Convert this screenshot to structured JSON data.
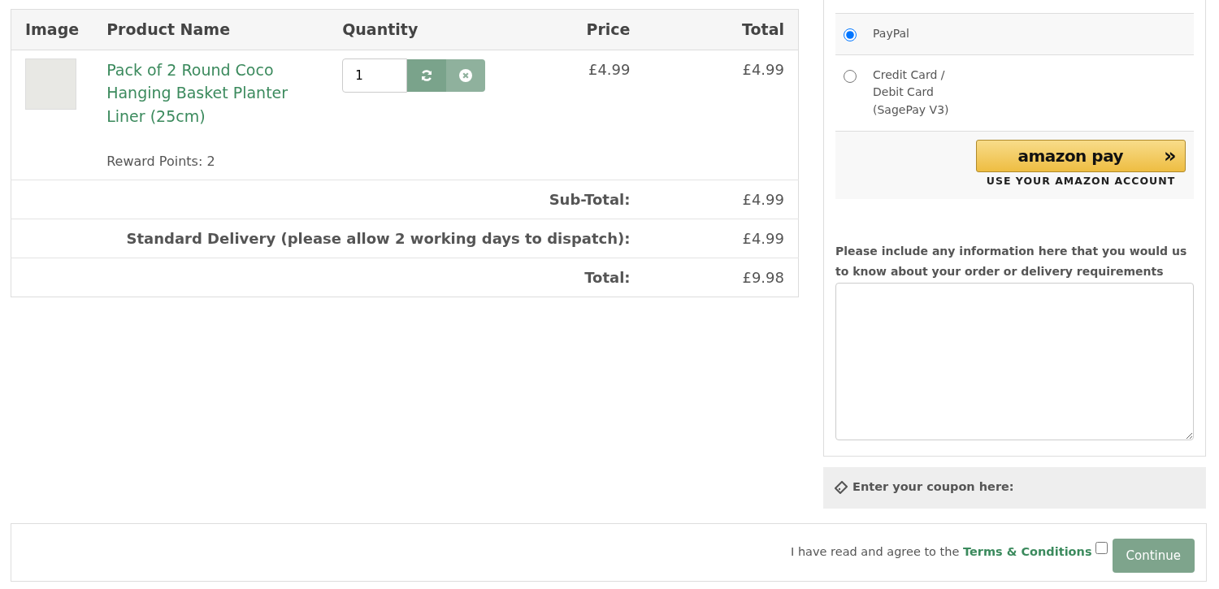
{
  "cart": {
    "columns": [
      {
        "label": "Image"
      },
      {
        "label": "Product Name"
      },
      {
        "label": "Quantity"
      },
      {
        "label": "Price"
      },
      {
        "label": "Total"
      }
    ],
    "items": [
      {
        "name": "Pack of 2 Round Coco Hanging Basket Planter Liner (25cm)",
        "reward": "Reward Points: 2",
        "quantity": "1",
        "price": "£4.99",
        "total": "£4.99"
      }
    ],
    "totals": [
      {
        "label": "Sub-Total:",
        "value": "£4.99"
      },
      {
        "label": "Standard Delivery (please allow 2 working days to dispatch):",
        "value": "£4.99"
      },
      {
        "label": "Total:",
        "value": "£9.98"
      }
    ]
  },
  "payment": {
    "methods": [
      {
        "label": "PayPal",
        "selected": true
      },
      {
        "label": "Credit Card /\nDebit Card\n(SagePay V3)",
        "selected": false
      }
    ],
    "amazon": {
      "logo": "amazon pay",
      "chevrons": "»",
      "caption": "USE YOUR AMAZON ACCOUNT"
    },
    "comment_label": "Please include any information here that you would us to know about your order or delivery requirements"
  },
  "coupon": {
    "label": "Enter your coupon here:"
  },
  "footer": {
    "agree_text": "I have read and agree to the",
    "terms_link": "Terms & Conditions",
    "agreed": false,
    "button": "Continue"
  }
}
